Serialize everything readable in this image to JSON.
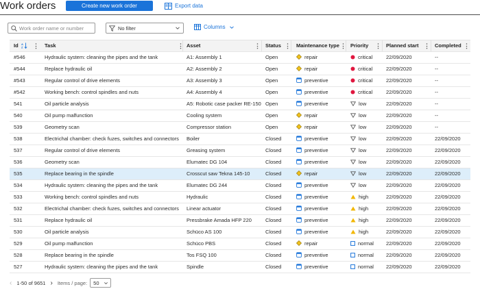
{
  "header": {
    "title": "Work orders",
    "create_label": "Create new work order",
    "export_label": "Export data"
  },
  "toolbar": {
    "search_placeholder": "Work order name or number",
    "filter_value": "No filter",
    "columns_label": "Columns"
  },
  "columns": [
    "Id",
    "Task",
    "Asset",
    "Status",
    "Maintenance type",
    "Priority",
    "Planned start",
    "Completed"
  ],
  "rows": [
    {
      "id": "#546",
      "task": "Hydraulic system: cleaning the pipes and the tank",
      "asset": "A1: Assembly 1",
      "status": "Open",
      "mtype": "repair",
      "priority": "critical",
      "start": "22/09/2020",
      "completed": "--"
    },
    {
      "id": "#544",
      "task": "Replace hydraulic oil",
      "asset": "A2: Assembly 2",
      "status": "Open",
      "mtype": "repair",
      "priority": "critical",
      "start": "22/09/2020",
      "completed": "--"
    },
    {
      "id": "#543",
      "task": "Regular control of drive elements",
      "asset": "A3: Assembly 3",
      "status": "Open",
      "mtype": "preventive",
      "priority": "critical",
      "start": "22/09/2020",
      "completed": "--"
    },
    {
      "id": "#542",
      "task": "Working bench: control spindles and nuts",
      "asset": "A4: Assembly 4",
      "status": "Open",
      "mtype": "preventive",
      "priority": "critical",
      "start": "22/09/2020",
      "completed": "--"
    },
    {
      "id": "541",
      "task": "Oil particle analysis",
      "asset": "A5: Robotic case packer RE-150",
      "status": "Open",
      "mtype": "preventive",
      "priority": "low",
      "start": "22/09/2020",
      "completed": "--"
    },
    {
      "id": "540",
      "task": "Oil pump malfunction",
      "asset": "Cooling system",
      "status": "Open",
      "mtype": "repair",
      "priority": "low",
      "start": "22/09/2020",
      "completed": "--"
    },
    {
      "id": "539",
      "task": "Geometry scan",
      "asset": "Compressor station",
      "status": "Open",
      "mtype": "repair",
      "priority": "low",
      "start": "22/09/2020",
      "completed": "--"
    },
    {
      "id": "538",
      "task": "Electrichal chamber: check fuzes, switches and connectors",
      "asset": "Boiler",
      "status": "Closed",
      "mtype": "preventive",
      "priority": "low",
      "start": "22/09/2020",
      "completed": "22/09/2020"
    },
    {
      "id": "537",
      "task": "Regular control of drive elements",
      "asset": "Greasing system",
      "status": "Closed",
      "mtype": "preventive",
      "priority": "low",
      "start": "22/09/2020",
      "completed": "22/09/2020"
    },
    {
      "id": "536",
      "task": "Geometry scan",
      "asset": "Elumatec DG 104",
      "status": "Closed",
      "mtype": "preventive",
      "priority": "low",
      "start": "22/09/2020",
      "completed": "22/09/2020"
    },
    {
      "id": "535",
      "task": "Replace bearing in the spindle",
      "asset": "Crosscut saw Tekna 145-10",
      "status": "Closed",
      "mtype": "repair",
      "priority": "low",
      "start": "22/09/2020",
      "completed": "22/09/2020"
    },
    {
      "id": "534",
      "task": "Hydraulic system: cleaning the pipes and the tank",
      "asset": "Elumatec DG 244",
      "status": "Closed",
      "mtype": "preventive",
      "priority": "low",
      "start": "22/09/2020",
      "completed": "22/09/2020"
    },
    {
      "id": "533",
      "task": "Working bench: control spindles and nuts",
      "asset": "Hydraulic",
      "status": "Closed",
      "mtype": "preventive",
      "priority": "high",
      "start": "22/09/2020",
      "completed": "22/09/2020"
    },
    {
      "id": "532",
      "task": "Electrichal chamber: check fuzes, switches and connectors",
      "asset": "Linear actuator",
      "status": "Closed",
      "mtype": "preventive",
      "priority": "high",
      "start": "22/09/2020",
      "completed": "22/09/2020"
    },
    {
      "id": "531",
      "task": "Replace hydraulic oil",
      "asset": "Pressbrake Amada HFP 220",
      "status": "Closed",
      "mtype": "preventive",
      "priority": "high",
      "start": "22/09/2020",
      "completed": "22/09/2020"
    },
    {
      "id": "530",
      "task": "Oil particle analysis",
      "asset": "Schüco AS 100",
      "status": "Closed",
      "mtype": "preventive",
      "priority": "high",
      "start": "22/09/2020",
      "completed": "22/09/2020"
    },
    {
      "id": "529",
      "task": "Oil pump malfunction",
      "asset": "Schüco PBS",
      "status": "Closed",
      "mtype": "repair",
      "priority": "normal",
      "start": "22/09/2020",
      "completed": "22/09/2020"
    },
    {
      "id": "528",
      "task": "Replace bearing in the spindle",
      "asset": "Tos FSQ 100",
      "status": "Closed",
      "mtype": "preventive",
      "priority": "normal",
      "start": "22/09/2020",
      "completed": "22/09/2020"
    },
    {
      "id": "527",
      "task": "Hydraulic system: cleaning the pipes and the tank",
      "asset": "Spindle",
      "status": "Closed",
      "mtype": "preventive",
      "priority": "normal",
      "start": "22/09/2020",
      "completed": "22/09/2020"
    }
  ],
  "selected_row_index": 10,
  "pager": {
    "range": "1-50 of 9651",
    "items_label": "Items / page:",
    "page_size": "50"
  },
  "colors": {
    "accent": "#1a73d9",
    "critical": "#e0173f",
    "high": "#f2b705",
    "repair": "#f2c21c",
    "preventive": "#1a73d9",
    "selected": "#ddeefa"
  }
}
